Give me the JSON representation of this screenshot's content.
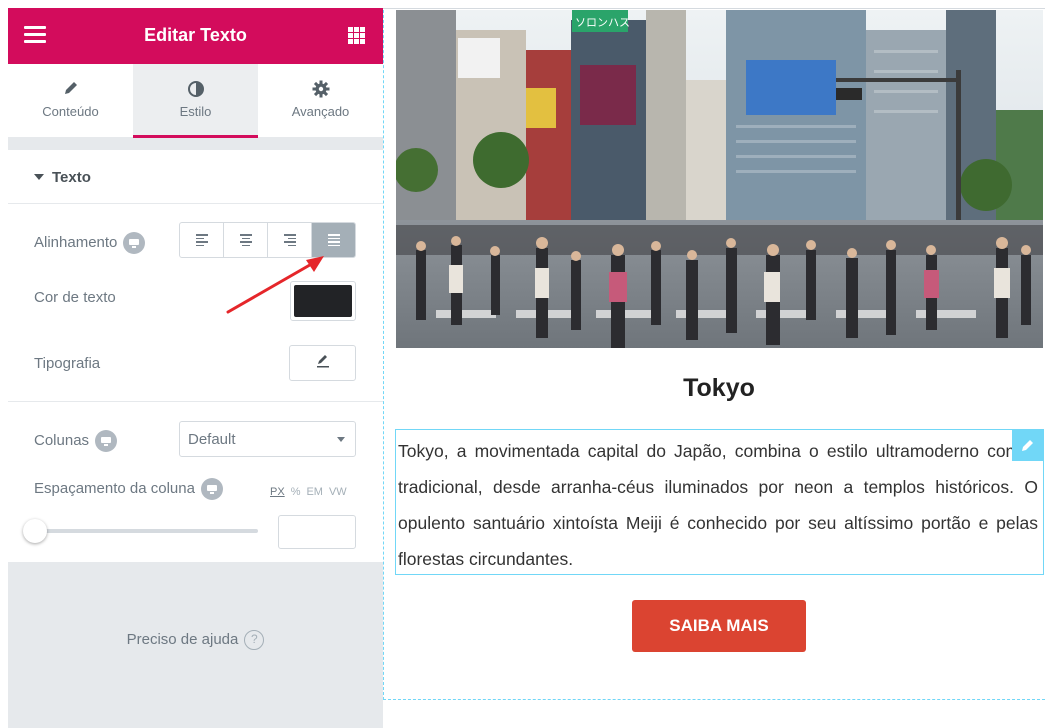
{
  "panel": {
    "title": "Editar Texto",
    "tabs": [
      {
        "label": "Conteúdo",
        "icon": "pencil-icon"
      },
      {
        "label": "Estilo",
        "icon": "half-circle-icon",
        "active": true
      },
      {
        "label": "Avançado",
        "icon": "gear-icon"
      }
    ],
    "section_title": "Texto",
    "controls": {
      "alignment_label": "Alinhamento",
      "alignment_options": [
        "left",
        "center",
        "right",
        "justify"
      ],
      "alignment_selected": "justify",
      "text_color_label": "Cor de texto",
      "text_color_value": "#222326",
      "typography_label": "Tipografia",
      "columns_label": "Colunas",
      "columns_value": "Default",
      "column_gap_label": "Espaçamento da coluna",
      "units": [
        "PX",
        "%",
        "EM",
        "VW"
      ],
      "unit_selected": "PX"
    },
    "help_text": "Preciso de ajuda",
    "help_icon": "?"
  },
  "preview": {
    "title": "Tokyo",
    "body": "Tokyo, a movimentada capital do Japão, combina o estilo ultramoderno com o tradicional, desde arranha-céus iluminados por neon a templos históricos. O opulento santuário xintoísta Meiji é conhecido por seu altíssimo portão e pelas florestas circundantes.",
    "button": "SAIBA MAIS",
    "sign_text": "ソロンハス"
  },
  "colors": {
    "header": "#d30c5c",
    "outline": "#71d7f7",
    "button": "#db4431",
    "annotation_arrow": "#e5262a"
  }
}
